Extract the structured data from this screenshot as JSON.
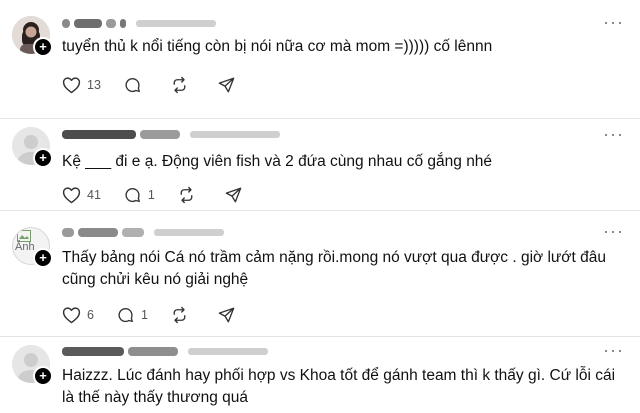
{
  "comments": [
    {
      "text": "tuyển thủ k nổi tiếng còn bị nói nữa cơ mà mom =))))) cố lênnn",
      "likes": "13",
      "replies": ""
    },
    {
      "text": "Kệ ___ đi e ạ. Động viên fish và 2 đứa cùng nhau cố gắng nhé",
      "likes": "41",
      "replies": "1"
    },
    {
      "text": "Thấy bảng nói Cá nó trầm cảm nặng rồi.mong nó vượt qua được . giờ lướt đâu cũng chửi kêu nó giải nghệ",
      "likes": "6",
      "replies": "1",
      "avatar_alt": "Ảnh"
    },
    {
      "text": "Haizzz. Lúc đánh hay phối hợp vs Khoa tốt để gánh team thì k thấy gì. Cứ lỗi cái là thế này thấy thương quá",
      "likes": "",
      "replies": ""
    }
  ],
  "icons": {
    "like": "heart-icon",
    "reply": "comment-bubble-icon",
    "repost": "repost-icon",
    "share": "share-send-icon",
    "follow": "plus-follow-icon",
    "more": "more-horizontal-icon"
  },
  "more_glyph": "···",
  "plus_glyph": "+"
}
